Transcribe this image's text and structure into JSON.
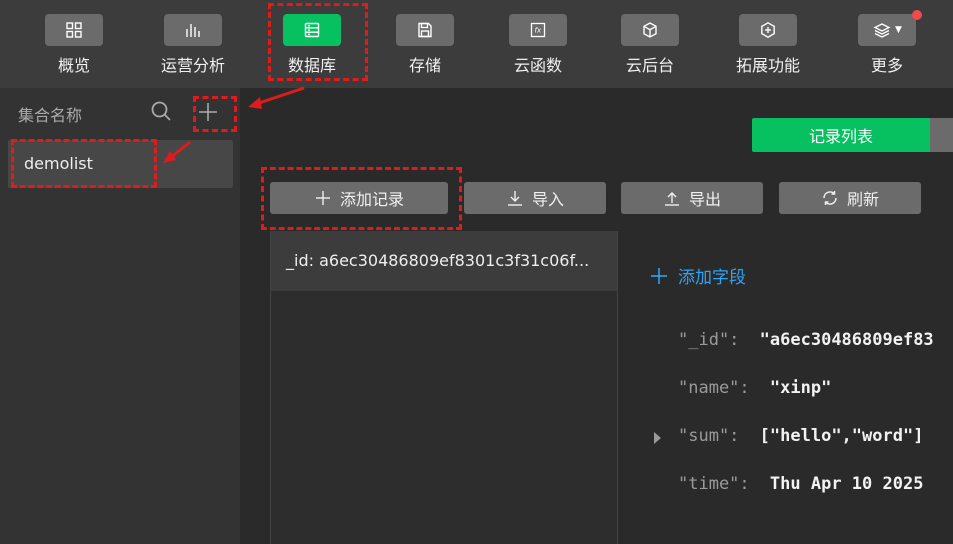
{
  "toolbar": {
    "items": [
      {
        "label": "概览",
        "icon": "overview-grid-icon"
      },
      {
        "label": "运营分析",
        "icon": "bar-chart-icon"
      },
      {
        "label": "数据库",
        "icon": "database-icon",
        "active": true
      },
      {
        "label": "存储",
        "icon": "floppy-disk-icon"
      },
      {
        "label": "云函数",
        "icon": "function-fx-icon"
      },
      {
        "label": "云后台",
        "icon": "cube-icon"
      },
      {
        "label": "拓展功能",
        "icon": "plus-hexagon-icon"
      },
      {
        "label": "更多",
        "icon": "layers-icon"
      }
    ]
  },
  "sidebar": {
    "title": "集合名称",
    "collections": [
      "demolist"
    ]
  },
  "main": {
    "view_tabs": [
      "记录列表"
    ],
    "actions": {
      "add_record": "添加记录",
      "import": "导入",
      "export": "导出",
      "refresh": "刷新"
    },
    "records": [
      "_id: a6ec30486809ef8301c3f31c06f..."
    ],
    "add_field": "添加字段",
    "fields": [
      {
        "key": "\"_id\":",
        "value": "\"a6ec30486809ef83"
      },
      {
        "key": "\"name\":",
        "value": "\"xinp\""
      },
      {
        "key": "\"sum\":",
        "value": "[\"hello\",\"word\"]"
      },
      {
        "key": "\"time\":",
        "value": "Thu Apr 10 2025"
      }
    ]
  },
  "colors": {
    "accent": "#07c160",
    "link": "#2ea3f2",
    "highlight": "#e01b1b",
    "notification": "#f04b4b"
  }
}
